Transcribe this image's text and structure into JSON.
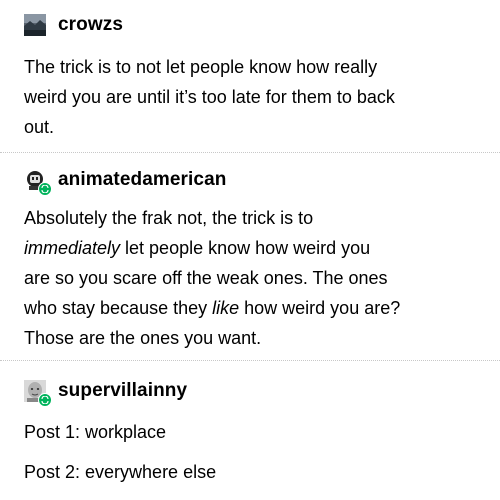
{
  "posts": [
    {
      "username": "crowzs",
      "avatar_icon": "landscape-avatar-icon",
      "reblogged": false,
      "lines": [
        "The trick is to not let people know how really",
        "weird you are until it’s too late for them to back",
        "out."
      ]
    },
    {
      "username": "animatedamerican",
      "avatar_icon": "robot-avatar-icon",
      "reblogged": true,
      "lines": [
        "Absolutely the frak not, the trick is to",
        [
          "immediately",
          " let people know how weird you"
        ],
        "are so you scare off the weak ones. The ones",
        [
          "who stay because they ",
          "like",
          " how weird you are?"
        ],
        "Those are the ones you want."
      ]
    },
    {
      "username": "supervillainny",
      "avatar_icon": "face-avatar-icon",
      "reblogged": true,
      "lines": [
        "Post 1: workplace",
        "Post 2: everywhere else"
      ]
    }
  ],
  "colors": {
    "reblog_badge": "#00b35c",
    "divider": "#c8c8c8",
    "text": "#000000"
  }
}
